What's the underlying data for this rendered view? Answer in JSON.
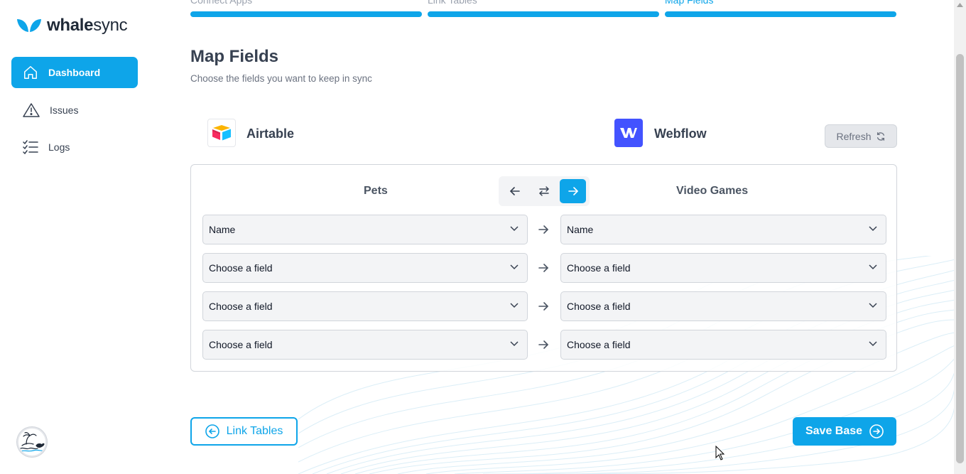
{
  "brand": {
    "name_bold": "whale",
    "name_light": "sync",
    "color": "#0ea5e9"
  },
  "sidebar": {
    "items": [
      {
        "label": "Dashboard",
        "icon": "home-icon",
        "active": true
      },
      {
        "label": "Issues",
        "icon": "warning-icon",
        "active": false
      },
      {
        "label": "Logs",
        "icon": "list-check-icon",
        "active": false
      }
    ]
  },
  "steps": [
    {
      "label": "Connect Apps",
      "state": "done"
    },
    {
      "label": "Link Tables",
      "state": "done"
    },
    {
      "label": "Map Fields",
      "state": "current"
    }
  ],
  "header": {
    "title": "Map Fields",
    "subtitle": "Choose the fields you want to keep in sync"
  },
  "apps": {
    "left": {
      "name": "Airtable",
      "icon": "airtable-logo"
    },
    "right": {
      "name": "Webflow",
      "icon": "webflow-logo"
    },
    "refresh_label": "Refresh"
  },
  "mapping": {
    "left_table": "Pets",
    "right_table": "Video Games",
    "direction": "left-to-right",
    "rows": [
      {
        "left": "Name",
        "right": "Name"
      },
      {
        "left": "Choose a field",
        "right": "Choose a field"
      },
      {
        "left": "Choose a field",
        "right": "Choose a field"
      },
      {
        "left": "Choose a field",
        "right": "Choose a field"
      }
    ]
  },
  "footer": {
    "back_label": "Link Tables",
    "save_label": "Save Base"
  }
}
